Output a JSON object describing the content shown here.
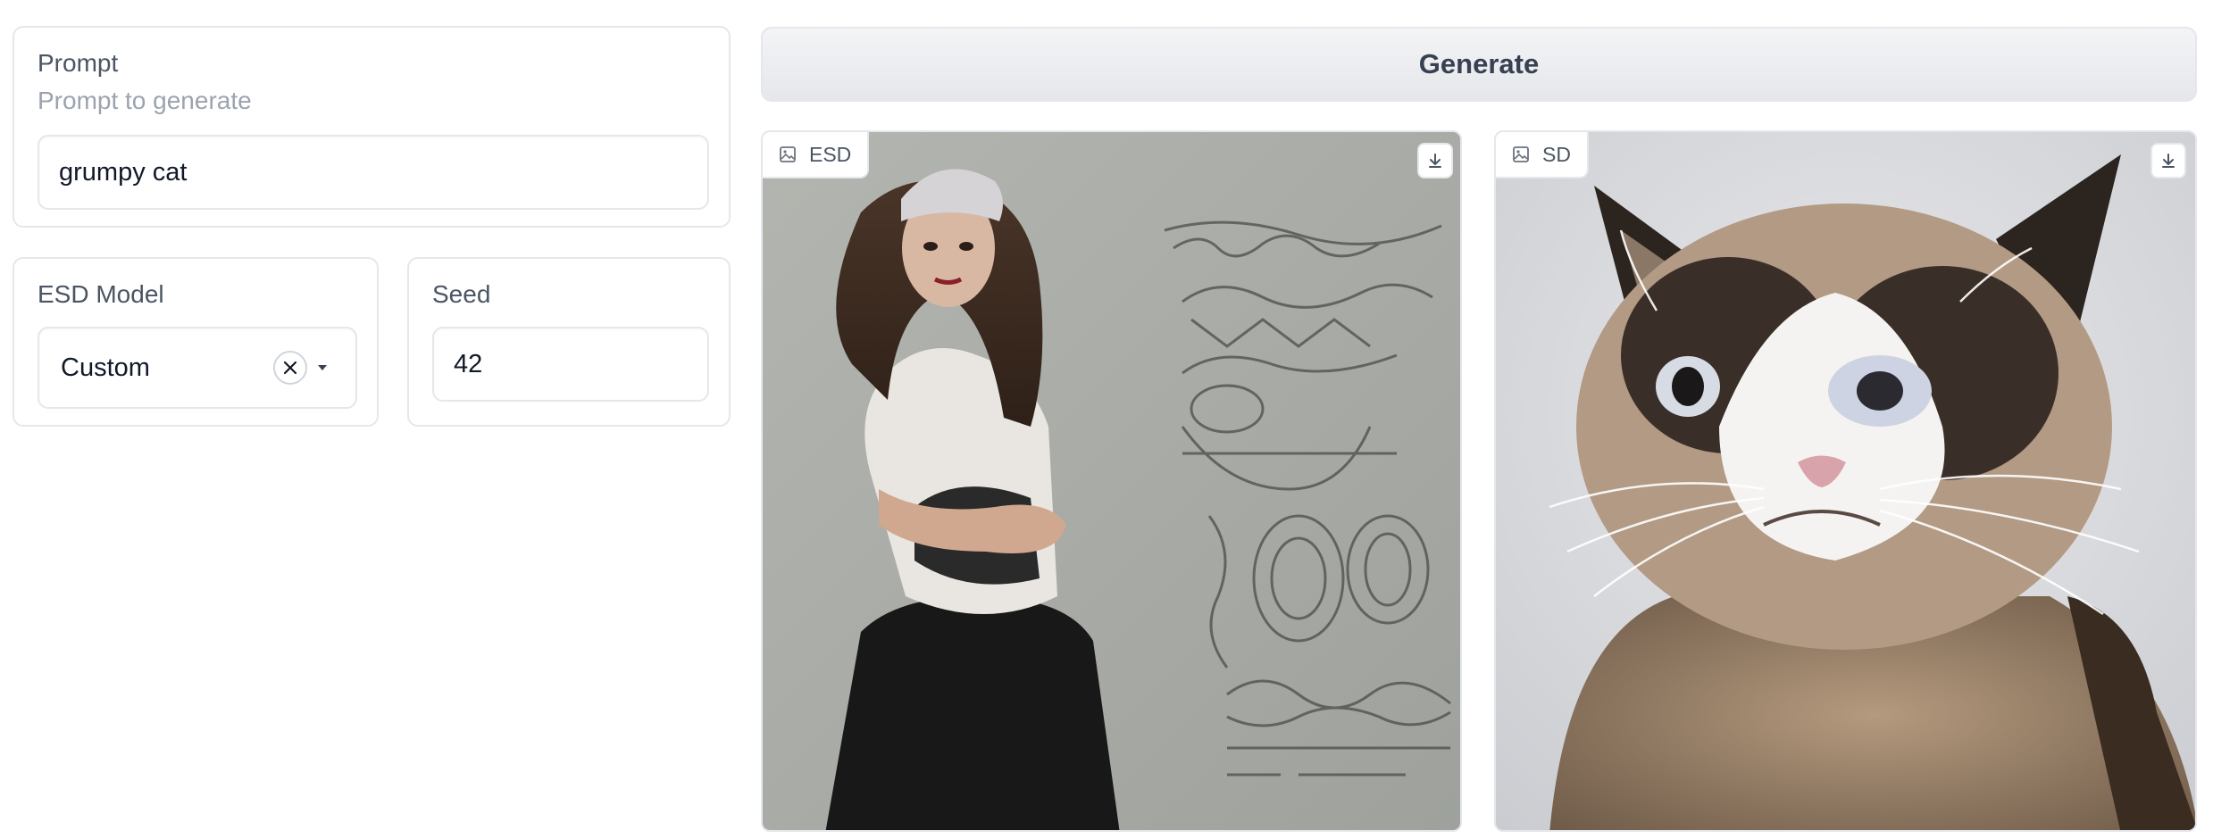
{
  "prompt": {
    "label": "Prompt",
    "info": "Prompt to generate",
    "value": "grumpy cat"
  },
  "esd_model": {
    "label": "ESD Model",
    "value": "Custom"
  },
  "seed": {
    "label": "Seed",
    "value": "42"
  },
  "generate_label": "Generate",
  "outputs": [
    {
      "label": "ESD"
    },
    {
      "label": "SD"
    }
  ]
}
